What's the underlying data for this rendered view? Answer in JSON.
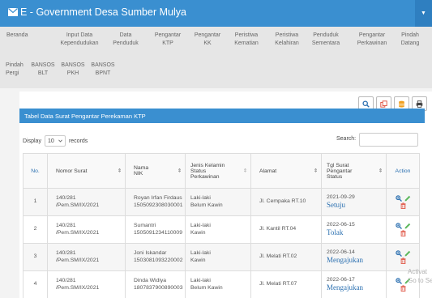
{
  "app": {
    "title": "E - Government Desa Sumber Mulya"
  },
  "nav": {
    "row1": [
      {
        "label": "Beranda"
      },
      {
        "label": "Input Data Kependudukan"
      },
      {
        "label": "Data Penduduk"
      },
      {
        "label": "Pengantar KTP"
      },
      {
        "label": "Pengantar KK"
      },
      {
        "label": "Peristiwa Kematian"
      },
      {
        "label": "Peristiwa Kelahiran"
      },
      {
        "label": "Penduduk Sementara"
      },
      {
        "label": "Pengantar Perkawinan"
      },
      {
        "label": "Pindah Datang"
      }
    ],
    "row2": [
      {
        "label": "Pindah Pergi"
      },
      {
        "label": "BANSOS BLT"
      },
      {
        "label": "BANSOS PKH"
      },
      {
        "label": "BANSOS BPNT"
      }
    ]
  },
  "panel": {
    "title": "Tabel Data Surat Pengantar Perekaman KTP"
  },
  "controls": {
    "display_label": "Display",
    "display_value": "10",
    "records_label": "records",
    "search_label": "Search:"
  },
  "table": {
    "headers": {
      "no": "No.",
      "nomor": "Nomor Surat",
      "nama1": "Nama",
      "nama2": "NIK",
      "jk1": "Jenis Kelamin",
      "jk2": "Status",
      "jk3": "Perkawinan",
      "alamat": "Alamat",
      "tgl1": "Tgl Surat",
      "tgl2": "Pengantar",
      "tgl3": "Status",
      "action": "Action"
    },
    "rows": [
      {
        "no": "1",
        "nomor1": "140/281",
        "nomor2": "/Pem.SM/IX/2021",
        "nama": "Royan Irfan Firdaus",
        "nik": "1505092308030001",
        "jk": "Laki-laki",
        "kawin": "Belum Kawin",
        "alamat": "Jl. Cempaka RT.10",
        "tgl": "2021-09-29",
        "status": "Setuju"
      },
      {
        "no": "2",
        "nomor1": "140/281",
        "nomor2": "/Pem.SM/IX/2021",
        "nama": "Sumantri",
        "nik": "1505091234110009",
        "jk": "Laki-laki",
        "kawin": "Kawin",
        "alamat": "Jl. Kantil RT.04",
        "tgl": "2022-06-15",
        "status": "Tolak"
      },
      {
        "no": "3",
        "nomor1": "140/281",
        "nomor2": "/Pem.SM/IX/2021",
        "nama": "Joni Iskandar",
        "nik": "1503081093220002",
        "jk": "Laki-laki",
        "kawin": "Kawin",
        "alamat": "Jl. Melati RT.02",
        "tgl": "2022-06-14",
        "status": "Mengajukan"
      },
      {
        "no": "4",
        "nomor1": "140/281",
        "nomor2": "/Pem.SM/IX/2021",
        "nama": "Dinda Widiya",
        "nik": "1807837900890003",
        "jk": "Laki-laki",
        "kawin": "Belum Kawin",
        "alamat": "Jl. Melati RT.07",
        "tgl": "2022-06-17",
        "status": "Mengajukan"
      }
    ]
  },
  "watermark": {
    "line1": "Activat",
    "line2": "Go to Se"
  },
  "colors": {
    "primary": "#3a8fd0",
    "edit": "#5cb85c",
    "delete": "#e05a4a",
    "view": "#2a6fb0"
  }
}
